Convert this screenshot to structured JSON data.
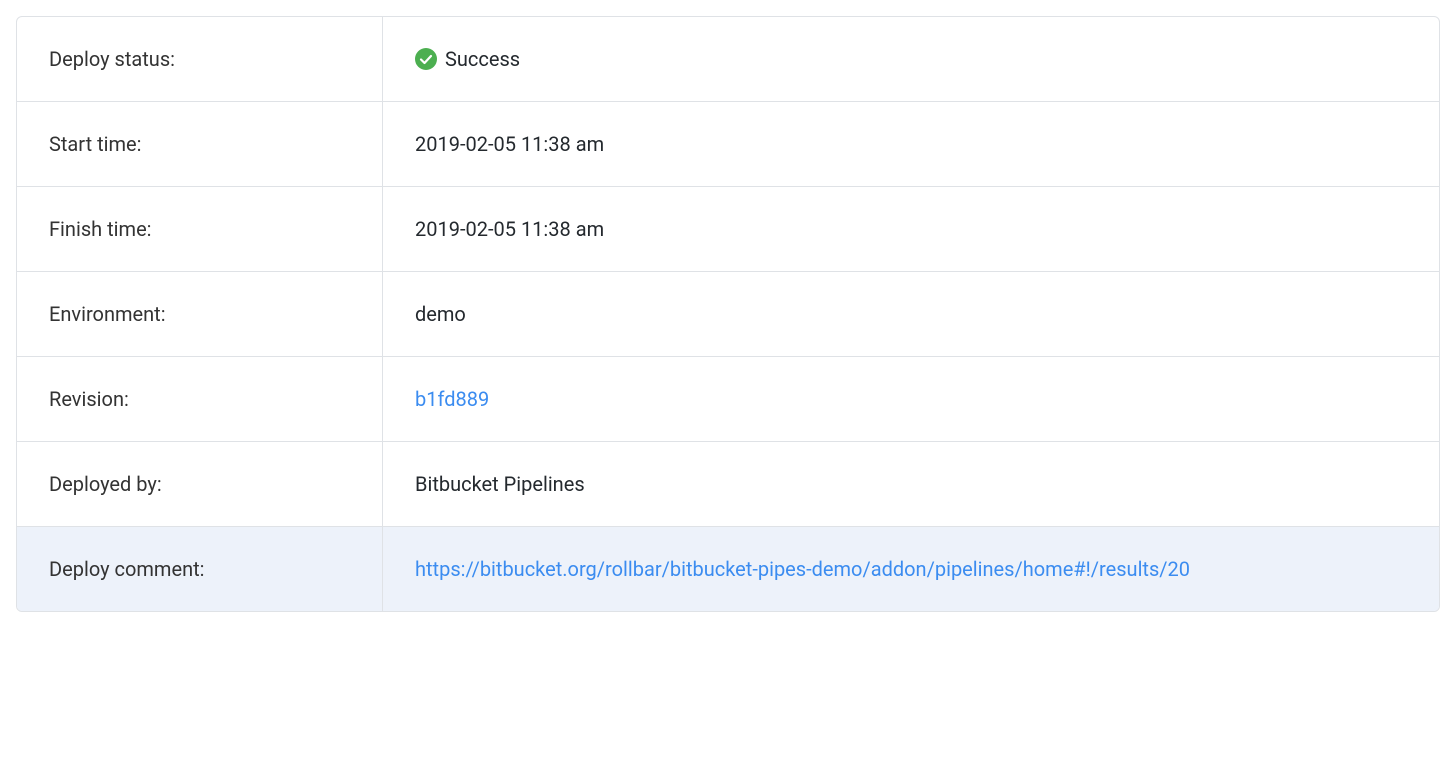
{
  "deploy": {
    "status_label": "Deploy status:",
    "status_value": "Success",
    "start_time_label": "Start time:",
    "start_time_value": "2019-02-05 11:38 am",
    "finish_time_label": "Finish time:",
    "finish_time_value": "2019-02-05 11:38 am",
    "environment_label": "Environment:",
    "environment_value": "demo",
    "revision_label": "Revision:",
    "revision_value": "b1fd889",
    "deployed_by_label": "Deployed by:",
    "deployed_by_value": "Bitbucket Pipelines",
    "deploy_comment_label": "Deploy comment:",
    "deploy_comment_value": "https://bitbucket.org/rollbar/bitbucket-pipes-demo/addon/pipelines/home#!/results/20"
  }
}
